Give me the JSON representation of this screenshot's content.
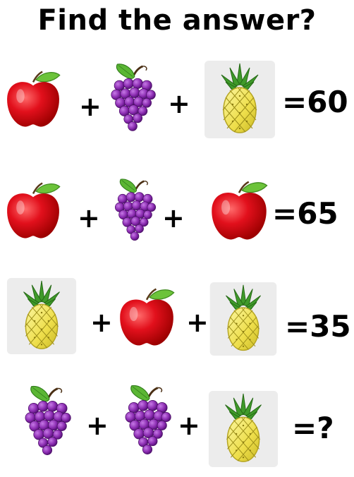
{
  "title": "Find the answer?",
  "colors": {
    "apple": "#e2101c",
    "apple_leaf": "#6cc33a",
    "grape": "#8a2bb0",
    "pineapple": "#f0ea5a",
    "pineapple_leaf": "#3f9a2a",
    "tile": "#ececec"
  },
  "equations": [
    {
      "terms": [
        "apple",
        "grapes",
        "pineapple"
      ],
      "operators": [
        "+",
        "+"
      ],
      "result": "=60"
    },
    {
      "terms": [
        "apple",
        "grapes",
        "apple"
      ],
      "operators": [
        "+",
        "+"
      ],
      "result": "=65"
    },
    {
      "terms": [
        "pineapple",
        "apple",
        "pineapple"
      ],
      "operators": [
        "+",
        "+"
      ],
      "result": "=35"
    },
    {
      "terms": [
        "grapes",
        "grapes",
        "pineapple"
      ],
      "operators": [
        "+",
        "+"
      ],
      "result": "=?"
    }
  ]
}
